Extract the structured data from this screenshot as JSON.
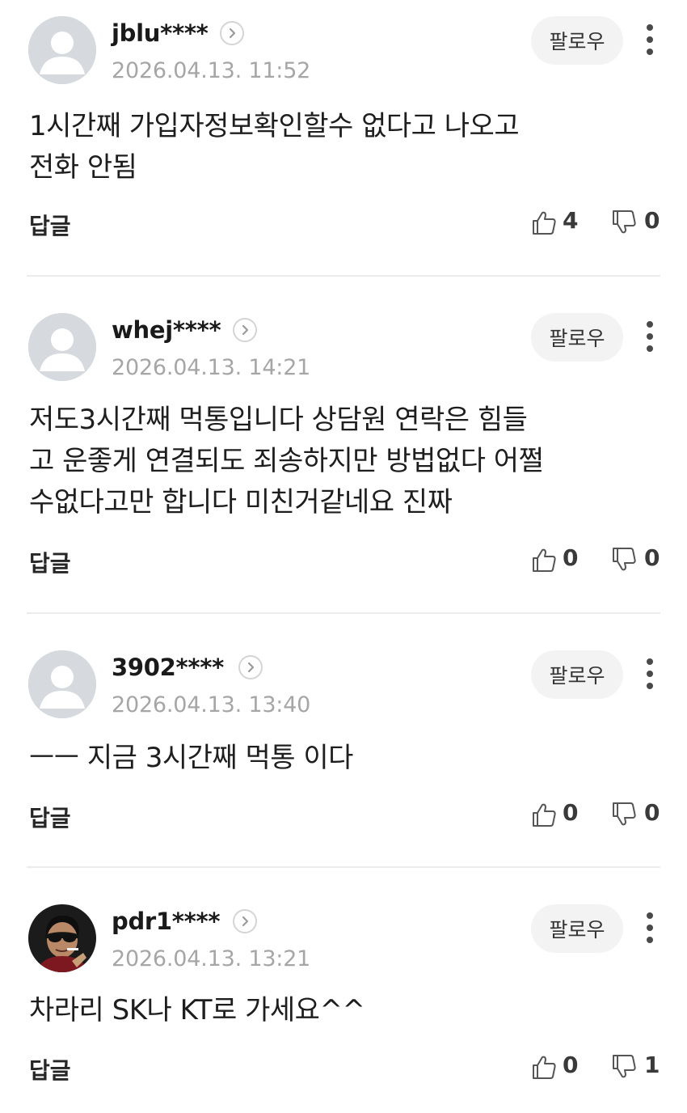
{
  "comments": [
    {
      "username": "jblu****",
      "date": "2026.04.13. 11:52",
      "follow_label": "팔로우",
      "avatar": "default-avatar",
      "text_lines": [
        "1시간째 가입자정보확인할수 없다고 나오고",
        "전화 안됨"
      ],
      "reply_label": "답글",
      "likes": "4",
      "dislikes": "0"
    },
    {
      "username": "whej****",
      "date": "2026.04.13. 14:21",
      "follow_label": "팔로우",
      "avatar": "default-avatar",
      "text_lines": [
        "저도3시간째 먹통입니다 상담원 연락은 힘들",
        "고 운좋게 연결되도 죄송하지만 방법없다 어쩔",
        "수없다고만 합니다 미친거같네요 진짜"
      ],
      "reply_label": "답글",
      "likes": "0",
      "dislikes": "0"
    },
    {
      "username": "3902****",
      "date": "2026.04.13. 13:40",
      "follow_label": "팔로우",
      "avatar": "default-avatar",
      "text_lines": [
        "ㅡㅡ 지금 3시간째 먹통 이다"
      ],
      "reply_label": "답글",
      "likes": "0",
      "dislikes": "0"
    },
    {
      "username": "pdr1****",
      "date": "2026.04.13. 13:21",
      "follow_label": "팔로우",
      "avatar": "photo-avatar-man-sunglasses",
      "text_lines": [
        "차라리 SK나 KT로 가세요^^"
      ],
      "reply_label": "답글",
      "likes": "0",
      "dislikes": "1"
    }
  ],
  "colors": {
    "username": "#1a1a1a",
    "date": "#a6a6a6",
    "follow_bg": "#f3f3f3",
    "divider": "#ececec",
    "avatar_bg": "#d6d9de"
  }
}
